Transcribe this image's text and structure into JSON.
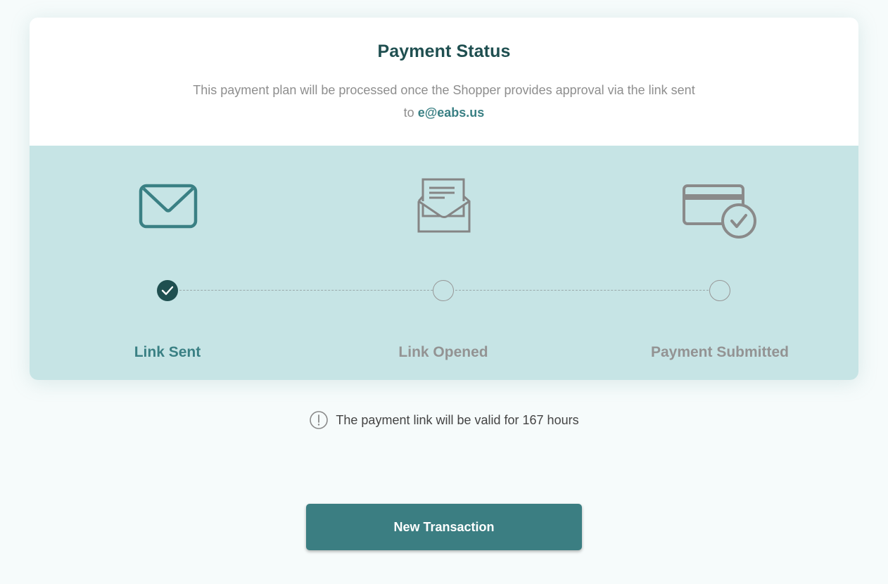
{
  "header": {
    "title": "Payment Status",
    "description_prefix": "This payment plan will be processed once the Shopper provides approval via the link sent to",
    "email": "e@eabs.us"
  },
  "steps": [
    {
      "label": "Link Sent",
      "icon": "envelope-closed-icon",
      "status": "complete",
      "color": "#3a8084"
    },
    {
      "label": "Link Opened",
      "icon": "envelope-open-icon",
      "status": "pending",
      "color": "#939393"
    },
    {
      "label": "Payment Submitted",
      "icon": "card-check-icon",
      "status": "pending",
      "color": "#939393"
    }
  ],
  "notice": {
    "icon": "exclamation-circle-icon",
    "text": "The payment link will be valid for 167 hours"
  },
  "actions": {
    "new_transaction_label": "New Transaction"
  },
  "colors": {
    "accent": "#3b7e82",
    "title": "#1f4f50",
    "tracker_bg": "#c6e4e5",
    "inactive": "#939393"
  }
}
